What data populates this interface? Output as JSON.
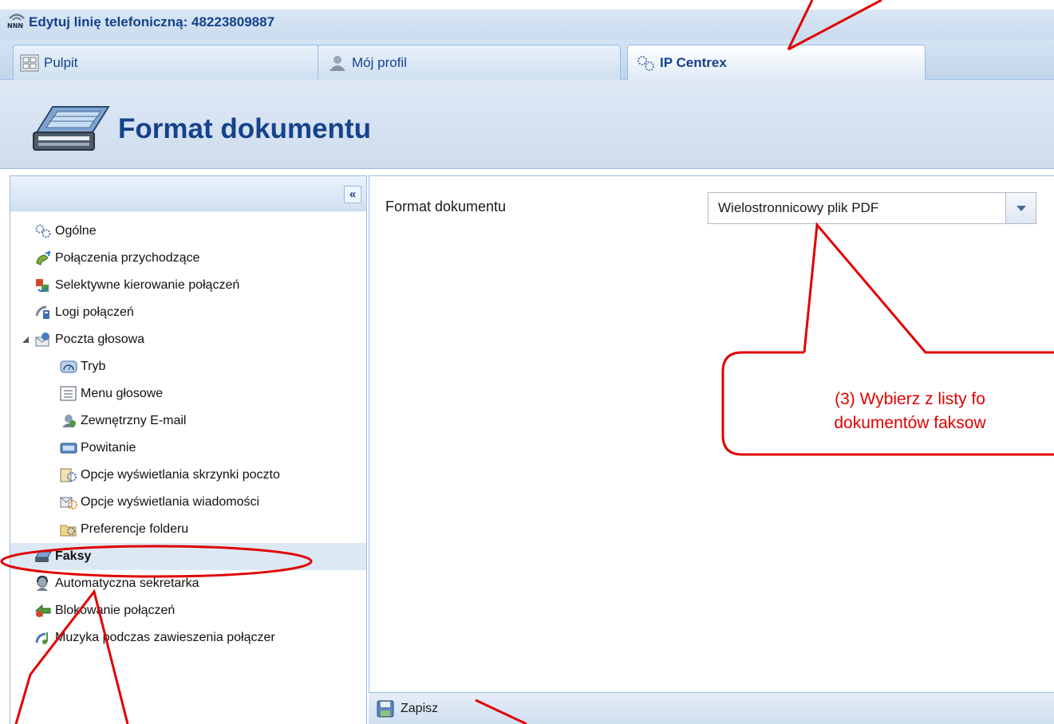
{
  "window": {
    "title": "Edytuj linię telefoniczną: 48223809887"
  },
  "tabs": [
    {
      "label": "Pulpit",
      "icon": "dashboard-icon",
      "active": false
    },
    {
      "label": "Mój profil",
      "icon": "user-profile-icon",
      "active": false
    },
    {
      "label": "IP Centrex",
      "icon": "gears-icon",
      "active": true
    }
  ],
  "header": {
    "title": "Format dokumentu",
    "icon": "fax-machine-icon"
  },
  "nav": {
    "collapse_label": "«",
    "items": [
      {
        "label": "Ogólne",
        "icon": "gears-icon",
        "level": 0
      },
      {
        "label": "Połączenia przychodzące",
        "icon": "incoming-call-icon",
        "level": 0
      },
      {
        "label": "Selektywne kierowanie połączeń",
        "icon": "call-routing-icon",
        "level": 0
      },
      {
        "label": "Logi połączeń",
        "icon": "call-log-icon",
        "level": 0
      },
      {
        "label": "Poczta głosowa",
        "icon": "voicemail-icon",
        "level": 0,
        "expanded": true
      },
      {
        "label": "Tryb",
        "icon": "mode-gauge-icon",
        "level": 1
      },
      {
        "label": "Menu głosowe",
        "icon": "voice-menu-icon",
        "level": 1
      },
      {
        "label": "Zewnętrzny E-mail",
        "icon": "external-email-icon",
        "level": 1
      },
      {
        "label": "Powitanie",
        "icon": "greeting-icon",
        "level": 1
      },
      {
        "label": "Opcje wyświetlania skrzynki poczto",
        "icon": "mailbox-display-icon",
        "level": 1
      },
      {
        "label": "Opcje wyświetlania wiadomości",
        "icon": "message-display-icon",
        "level": 1
      },
      {
        "label": "Preferencje folderu",
        "icon": "folder-preferences-icon",
        "level": 1
      },
      {
        "label": "Faksy",
        "icon": "fax-icon",
        "level": 0,
        "selected": true
      },
      {
        "label": "Automatyczna sekretarka",
        "icon": "auto-attendant-icon",
        "level": 0
      },
      {
        "label": "Blokowanie połączeń",
        "icon": "call-blocking-icon",
        "level": 0
      },
      {
        "label": "Muzyka podczas zawieszenia połączer",
        "icon": "music-on-hold-icon",
        "level": 0
      }
    ]
  },
  "form": {
    "field_label": "Format dokumentu",
    "select_value": "Wielostronnicowy plik PDF"
  },
  "footer": {
    "save_label": "Zapisz",
    "icon": "floppy-save-icon"
  },
  "annotation": {
    "callout_line1": "(3) Wybierz z listy fo",
    "callout_line2": "dokumentów faksow",
    "color": "#e00000"
  }
}
